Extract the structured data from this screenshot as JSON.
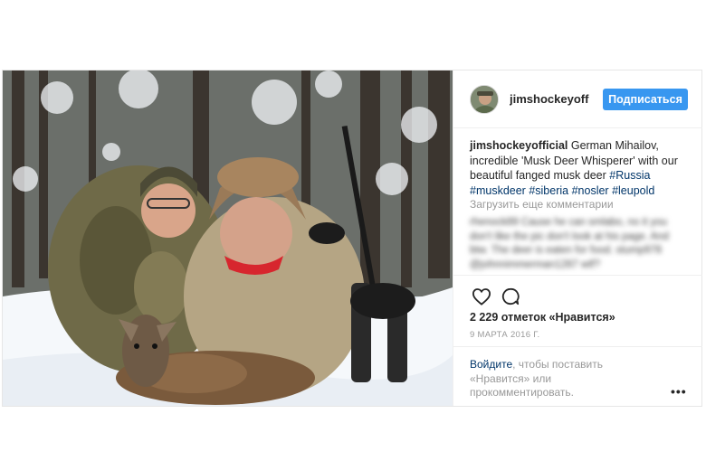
{
  "post": {
    "username": "jimshockeyofficial",
    "follow_label": "Подписаться",
    "caption": {
      "username": "jimshockeyofficial",
      "text": " German Mihailov, incredible 'Musk Deer Whisperer' with our beautiful fanged musk deer ",
      "tags": [
        "#Russia",
        "#muskdeer",
        "#siberia",
        "#nosler",
        "#leupold"
      ]
    },
    "load_more_label": "Загрузить еще комментарии",
    "blurred_comments": "rhenock89 Cause he can smlabo, no it you don't like the pic don't look at his page. And btw. The deer is eaten for food. stump978 @johnnimmerman1287 wtf?",
    "likes": "2 229 отметок «Нравится»",
    "date": "9 МАРТА 2016 Г.",
    "login": {
      "link": "Войдите",
      "text": ", чтобы поставить «Нравится» или прокомментировать."
    },
    "more_label": "•••"
  },
  "icons": {
    "like": "heart-icon",
    "comment": "comment-icon",
    "more": "more-options-icon"
  },
  "colors": {
    "follow_button": "#3897f0",
    "hashtag": "#003569",
    "muted": "#999999"
  }
}
